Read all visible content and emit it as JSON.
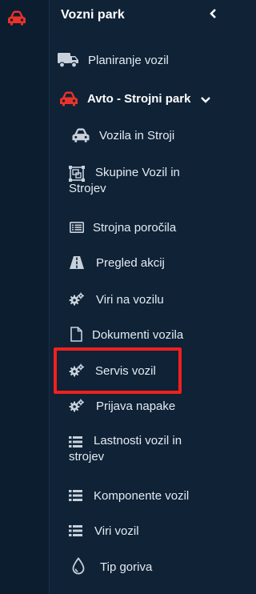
{
  "colors": {
    "background": "#0f2236",
    "rail": "#0c1d2f",
    "text": "#e4ebf2",
    "icon": "#c8d1db",
    "accent_red": "#e8322a",
    "highlight_border": "#f0201e"
  },
  "rail": {
    "icon": "car-icon"
  },
  "header": {
    "title": "Vozni park",
    "collapse_icon": "chevron-left-icon"
  },
  "menu": {
    "planning": {
      "label": "Planiranje vozil",
      "icon": "truck-icon"
    },
    "group": {
      "label": "Avto - Strojni park",
      "icon": "car-icon",
      "toggle_icon": "chevron-down-icon"
    },
    "items": [
      {
        "label": "Vozila in Stroji",
        "icon": "car-icon"
      },
      {
        "label": "Skupine Vozil in Strojev",
        "icon": "object-group-icon"
      },
      {
        "label": "Strojna poročila",
        "icon": "list-alt-icon"
      },
      {
        "label": "Pregled akcij",
        "icon": "road-icon"
      },
      {
        "label": "Viri na vozilu",
        "icon": "cogs-icon"
      },
      {
        "label": "Dokumenti vozila",
        "icon": "file-icon"
      },
      {
        "label": "Servis vozil",
        "icon": "cogs-icon",
        "highlighted": true
      },
      {
        "label": "Prijava napake",
        "icon": "cogs-icon"
      },
      {
        "label": "Lastnosti vozil in strojev",
        "icon": "list-icon"
      },
      {
        "label": "Komponente vozil",
        "icon": "list-icon"
      },
      {
        "label": "Viri vozil",
        "icon": "list-icon"
      },
      {
        "label": "Tip goriva",
        "icon": "tint-icon"
      }
    ]
  }
}
